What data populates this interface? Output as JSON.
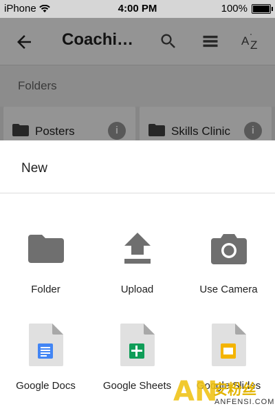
{
  "status_bar": {
    "carrier": "iPhone",
    "time": "4:00 PM",
    "battery": "100%"
  },
  "app_bar": {
    "title": "Coachi…",
    "icons": [
      "back-arrow-icon",
      "search-icon",
      "list-view-icon",
      "sort-az-icon"
    ]
  },
  "section": {
    "label": "Folders"
  },
  "folders": [
    {
      "name": "Posters"
    },
    {
      "name": "Skills Clinic"
    }
  ],
  "sheet": {
    "title": "New",
    "items": [
      {
        "label": "Folder",
        "icon": "folder-icon"
      },
      {
        "label": "Upload",
        "icon": "upload-icon"
      },
      {
        "label": "Use Camera",
        "icon": "camera-icon"
      },
      {
        "label": "Google Docs",
        "icon": "google-docs-icon"
      },
      {
        "label": "Google Sheets",
        "icon": "google-sheets-icon"
      },
      {
        "label": "Google Slides",
        "icon": "google-slides-icon"
      }
    ]
  },
  "watermark": {
    "logo": "AN",
    "chinese": "安粉丝",
    "site": "ANFENSI.COM"
  },
  "colors": {
    "docs": "#4285f4",
    "sheets": "#0f9d58",
    "slides": "#f4b400",
    "icon_gray": "#6f6f6f"
  }
}
